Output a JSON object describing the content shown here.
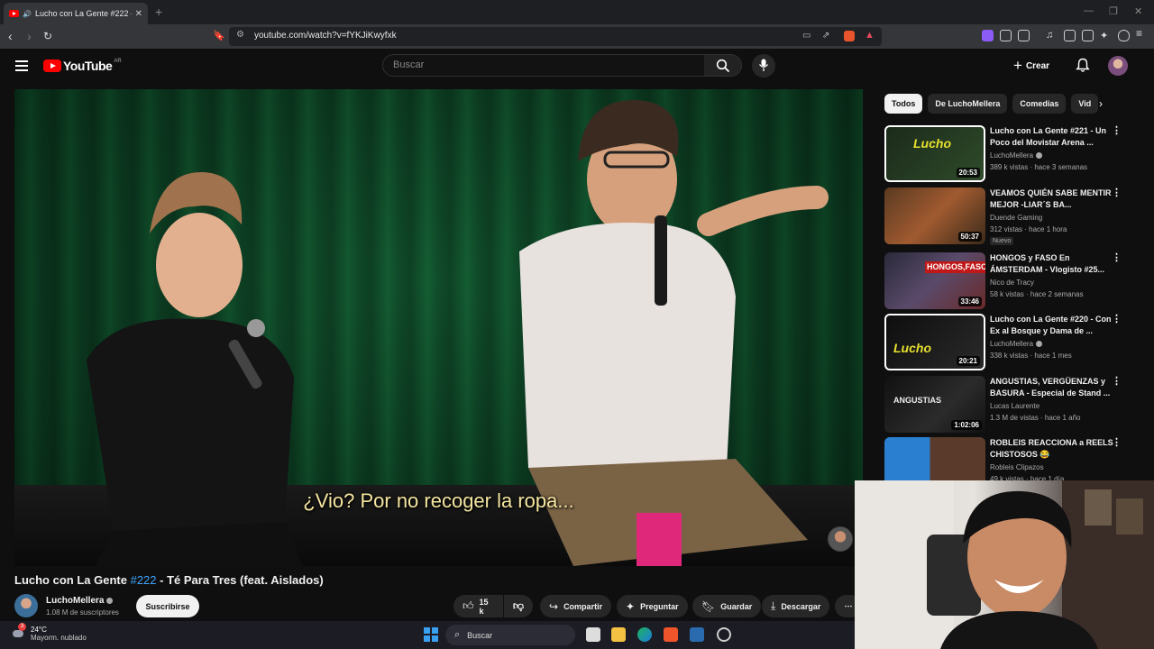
{
  "browser": {
    "tab_title": "Lucho con La Gente #222 - Té",
    "url": "youtube.com/watch?v=fYKJiKwyfxk"
  },
  "header": {
    "logo_text": "YouTube",
    "country_code": "AR",
    "search_placeholder": "Buscar",
    "create_label": "Crear"
  },
  "video": {
    "subtitle": "¿Vio? Por no recoger la ropa...",
    "title_prefix": "Lucho con La Gente",
    "title_tag": "#222",
    "title_suffix": "- Té Para Tres (feat. Aislados)"
  },
  "channel": {
    "name": "LuchoMellera",
    "subscribers": "1.08 M de suscriptores",
    "subscribe_label": "Suscribirse"
  },
  "actions": {
    "likes": "15 k",
    "share": "Compartir",
    "ask": "Preguntar",
    "save": "Guardar",
    "download": "Descargar"
  },
  "chips": [
    "Todos",
    "De LuchoMellera",
    "Comedias",
    "Vid"
  ],
  "recommendations": [
    {
      "title": "Lucho con La Gente #221 - Un Poco del Movistar Arena ...",
      "channel": "LuchoMellera",
      "verified": true,
      "meta": "389 k vistas · hace 3 semanas",
      "duration": "20:53",
      "new": ""
    },
    {
      "title": "VEAMOS QUIÉN SABE MENTIR MEJOR -LIAR´S BA...",
      "channel": "Duende Gaming",
      "verified": false,
      "meta": "312 vistas · hace 1 hora",
      "duration": "50:37",
      "new": "Nuevo"
    },
    {
      "title": "HONGOS y FASO En ÁMSTERDAM - Vlogisto #25...",
      "channel": "Nico de Tracy",
      "verified": false,
      "meta": "58 k vistas · hace 2 semanas",
      "duration": "33:46",
      "new": ""
    },
    {
      "title": "Lucho con La Gente #220 - Con Ex al Bosque y Dama de ...",
      "channel": "LuchoMellera",
      "verified": true,
      "meta": "338 k vistas · hace 1 mes",
      "duration": "20:21",
      "new": ""
    },
    {
      "title": "ANGUSTIAS, VERGÜENZAS y BASURA - Especial de Stand ...",
      "channel": "Lucas Laurente",
      "verified": false,
      "meta": "1.3 M de vistas · hace 1 año",
      "duration": "1:02:06",
      "new": ""
    },
    {
      "title": "ROBLEIS REACCIONA a REELS CHISTOSOS 😂",
      "channel": "Robleis Clipazos",
      "verified": false,
      "meta": "49 k vistas · hace 1 día",
      "duration": "",
      "new": ""
    }
  ],
  "taskbar": {
    "notification_count": "3",
    "temperature": "24°C",
    "weather": "Mayorm. nublado",
    "search_label": "Buscar"
  }
}
